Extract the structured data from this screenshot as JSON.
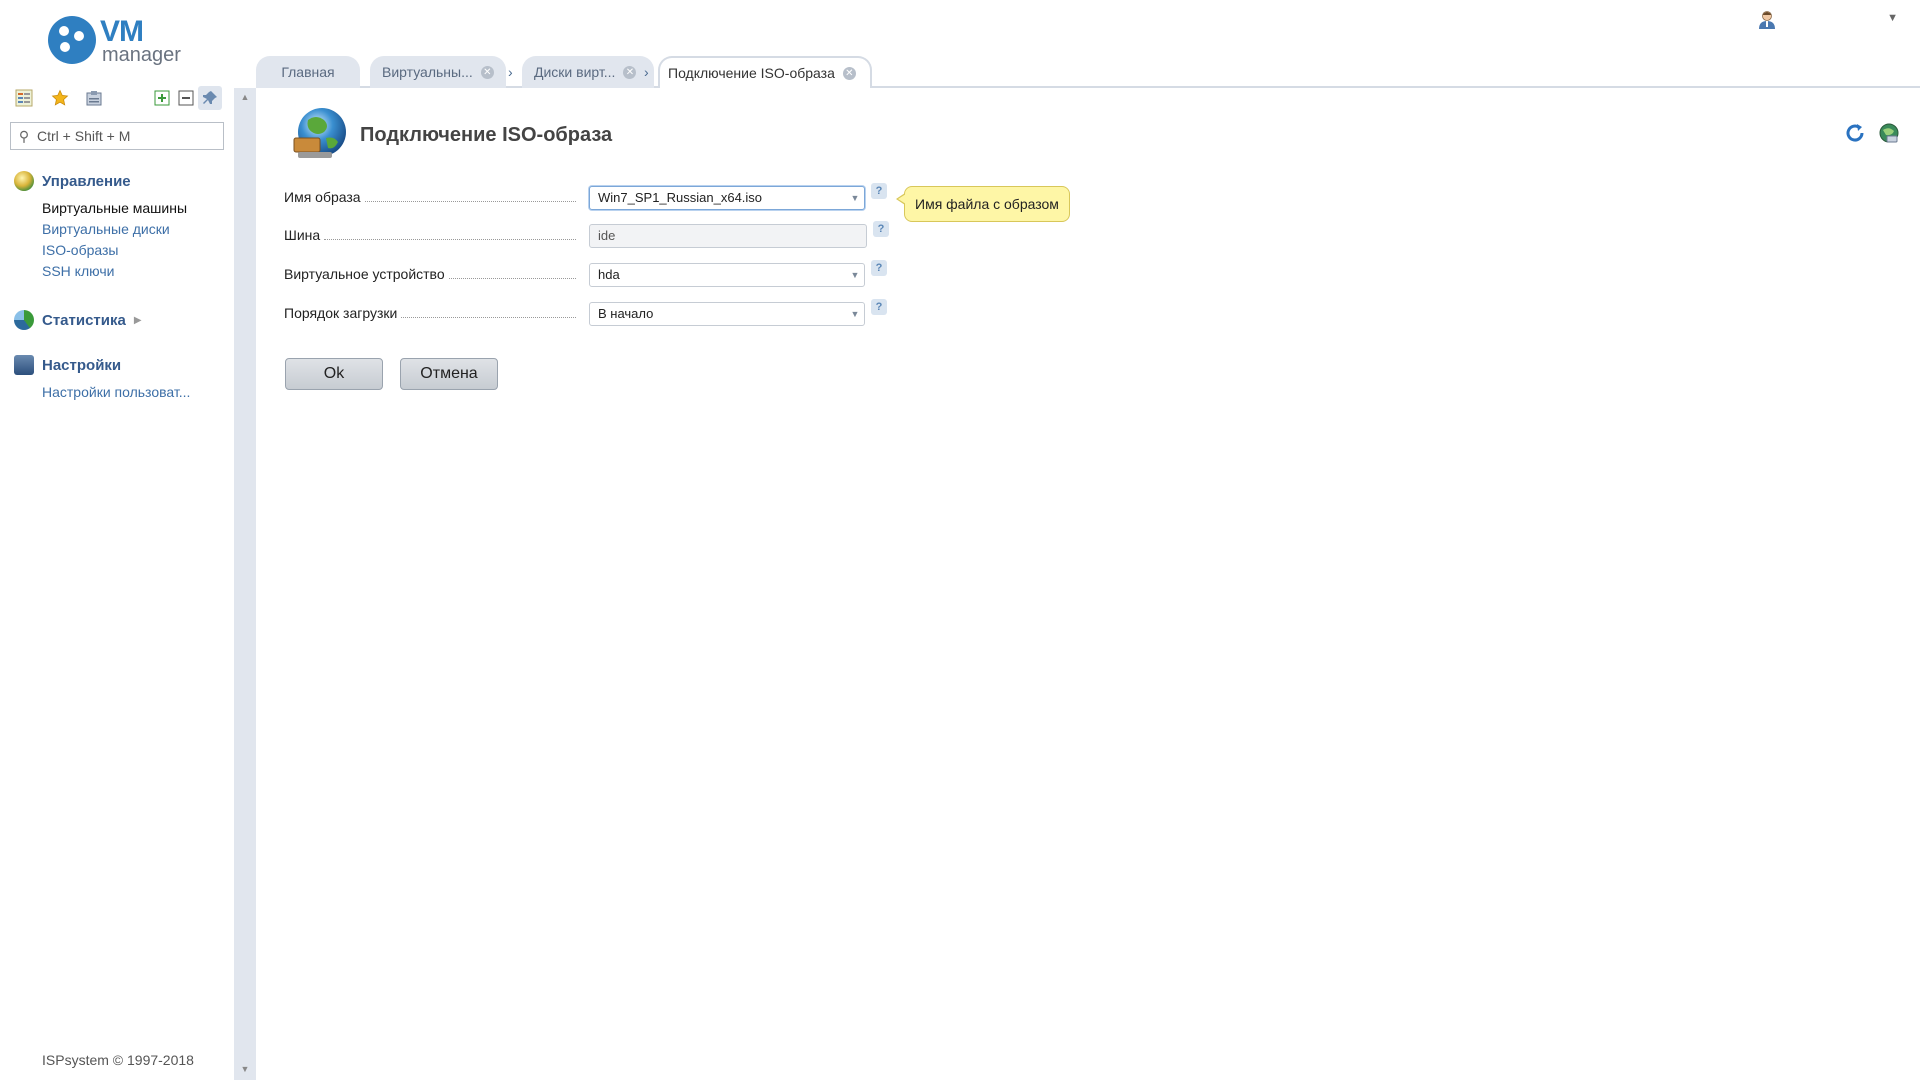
{
  "logo": {
    "primary": "VM",
    "secondary": "manager"
  },
  "sidebar": {
    "search_placeholder": "Ctrl + Shift + M",
    "groups": [
      {
        "title": "Управление",
        "items": [
          {
            "label": "Виртуальные машины",
            "active": true
          },
          {
            "label": "Виртуальные диски"
          },
          {
            "label": "ISO-образы"
          },
          {
            "label": "SSH ключи"
          }
        ]
      },
      {
        "title": "Статистика",
        "items": []
      },
      {
        "title": "Настройки",
        "items": [
          {
            "label": "Настройки пользоват..."
          }
        ]
      }
    ],
    "copyright": "ISPsystem © 1997-2018"
  },
  "tabs": [
    {
      "label": "Главная"
    },
    {
      "label": "Виртуальны..."
    },
    {
      "label": "Диски вирт..."
    },
    {
      "label": "Подключение ISO-образа",
      "active": true
    }
  ],
  "page": {
    "title": "Подключение ISO-образа"
  },
  "form": {
    "image_name": {
      "label": "Имя образа",
      "value": "Win7_SP1_Russian_x64.iso"
    },
    "bus": {
      "label": "Шина",
      "value": "ide"
    },
    "virtual_device": {
      "label": "Виртуальное устройство",
      "value": "hda"
    },
    "boot_order": {
      "label": "Порядок загрузки",
      "value": "В начало"
    },
    "tooltip": "Имя файла с образом",
    "ok_label": "Ok",
    "cancel_label": "Отмена"
  },
  "colors": {
    "accent": "#2f7fc1",
    "menu_title": "#355a8c",
    "link": "#3d6fa7",
    "tooltip_bg": "#fef6a6"
  }
}
